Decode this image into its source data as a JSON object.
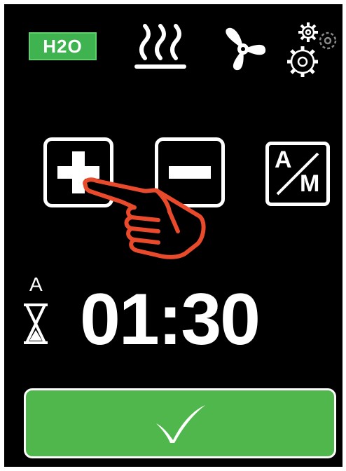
{
  "header": {
    "water_label": "H2O",
    "icons": [
      "steam-icon",
      "fan-icon",
      "gears-icon"
    ]
  },
  "controls": {
    "plus_icon": "plus-icon",
    "minus_icon": "minus-icon",
    "auto_manual": {
      "top": "A",
      "bottom": "M"
    }
  },
  "timer": {
    "mode": "A",
    "value": "01:30",
    "icon": "hourglass-icon"
  },
  "confirm": {
    "icon": "checkmark-icon"
  },
  "colors": {
    "accent": "#4fb74c",
    "background": "#000000",
    "hand": "#e84a2b"
  }
}
